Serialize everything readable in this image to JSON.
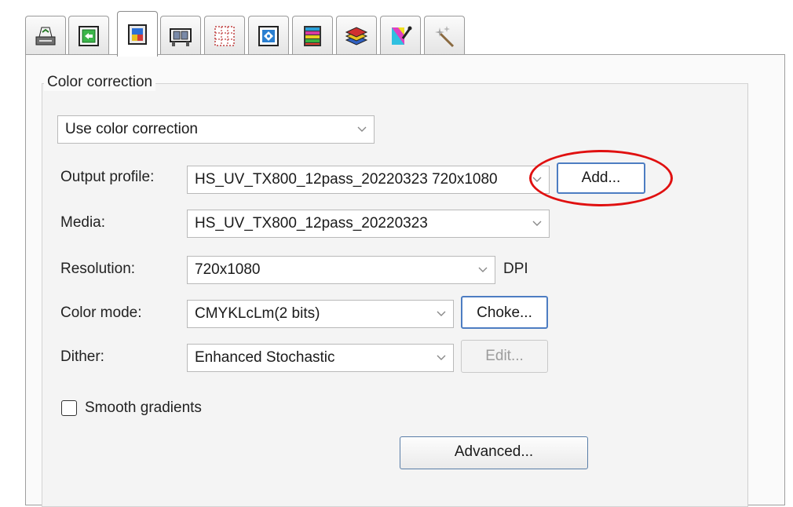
{
  "tabs": [
    {
      "icon": "printer-setup-icon",
      "active": false
    },
    {
      "icon": "page-layout-icon",
      "active": false
    },
    {
      "icon": "color-management-icon",
      "active": true
    },
    {
      "icon": "media-tiling-icon",
      "active": false
    },
    {
      "icon": "grid-marks-icon",
      "active": false
    },
    {
      "icon": "crop-position-icon",
      "active": false
    },
    {
      "icon": "color-bars-icon",
      "active": false
    },
    {
      "icon": "layers-icon",
      "active": false
    },
    {
      "icon": "color-picker-icon",
      "active": false
    },
    {
      "icon": "magic-wand-icon",
      "active": false
    }
  ],
  "color_correction": {
    "group_label": "Color correction",
    "mode_select": "Use color correction",
    "output_profile": {
      "label": "Output profile:",
      "value": "HS_UV_TX800_12pass_20220323 720x1080",
      "button": "Add..."
    },
    "media": {
      "label": "Media:",
      "value": "HS_UV_TX800_12pass_20220323"
    },
    "resolution": {
      "label": "Resolution:",
      "value": "720x1080",
      "unit": "DPI"
    },
    "color_mode": {
      "label": "Color mode:",
      "value": "CMYKLcLm(2 bits)",
      "button": "Choke..."
    },
    "dither": {
      "label": "Dither:",
      "value": "Enhanced Stochastic",
      "button": "Edit..."
    },
    "smooth_gradients": {
      "label": "Smooth gradients",
      "checked": false
    },
    "advanced_button": "Advanced..."
  },
  "annotation_color": "#e01010"
}
